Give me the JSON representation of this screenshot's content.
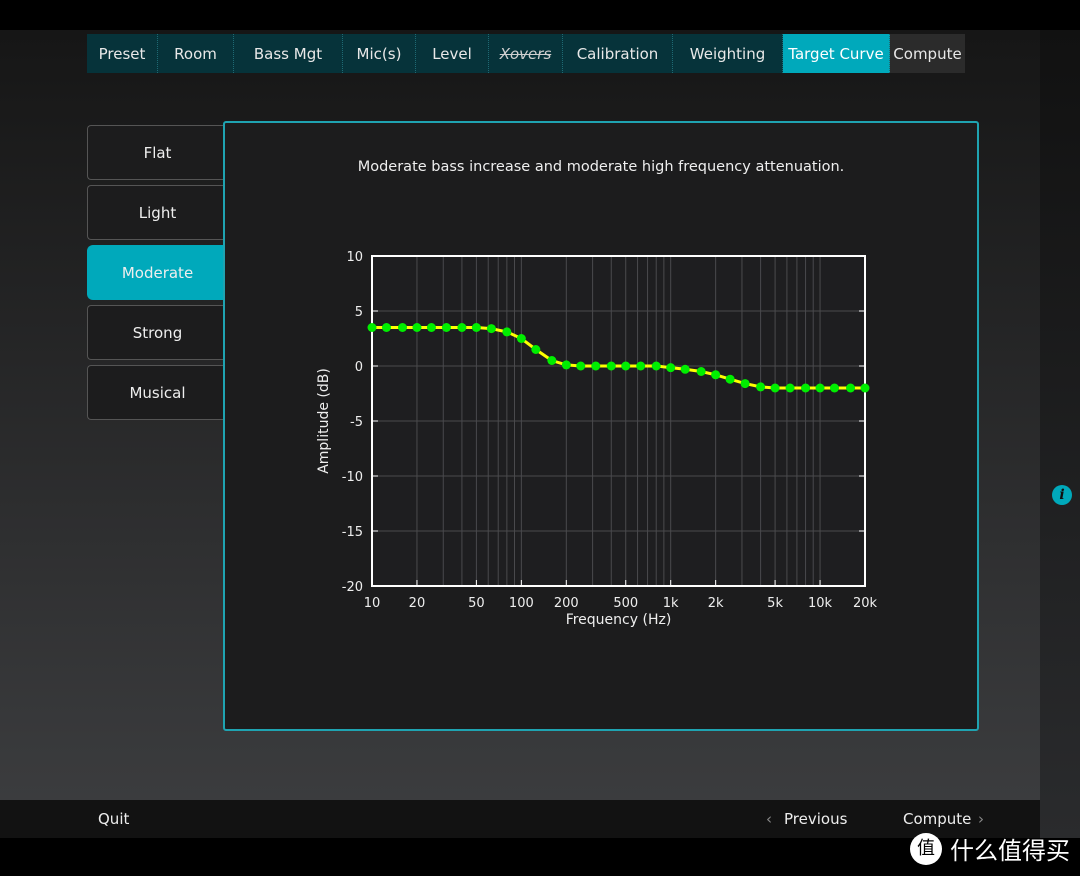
{
  "tabs": [
    {
      "label": "Preset"
    },
    {
      "label": "Room"
    },
    {
      "label": "Bass Mgt"
    },
    {
      "label": "Mic(s)"
    },
    {
      "label": "Level"
    },
    {
      "label": "Xovers"
    },
    {
      "label": "Calibration"
    },
    {
      "label": "Weighting"
    },
    {
      "label": "Target Curve"
    },
    {
      "label": "Compute"
    }
  ],
  "active_tab": "Target Curve",
  "presets": [
    {
      "label": "Flat"
    },
    {
      "label": "Light"
    },
    {
      "label": "Moderate"
    },
    {
      "label": "Strong"
    },
    {
      "label": "Musical"
    }
  ],
  "selected_preset": "Moderate",
  "description": "Moderate bass increase and moderate high frequency attenuation.",
  "footer": {
    "quit": "Quit",
    "previous": "Previous",
    "next": "Compute",
    "prev_icon": "‹",
    "next_icon": "›"
  },
  "info_icon": "i",
  "watermark": {
    "badge": "值",
    "text": "什么值得买"
  },
  "colors": {
    "accent": "#00a9bb",
    "line": "#ffff00",
    "points": "#00ee00"
  },
  "chart_data": {
    "type": "line",
    "xlabel": "Frequency (Hz)",
    "ylabel": "Amplitude (dB)",
    "xscale": "log",
    "xlim": [
      10,
      20000
    ],
    "ylim": [
      -20,
      10
    ],
    "grid": true,
    "xticks": [
      10,
      20,
      50,
      100,
      200,
      500,
      1000,
      2000,
      5000,
      10000,
      20000
    ],
    "xticklabels": [
      "10",
      "20",
      "50",
      "100",
      "200",
      "500",
      "1k",
      "2k",
      "5k",
      "10k",
      "20k"
    ],
    "yticks": [
      10,
      5,
      0,
      -5,
      -10,
      -15,
      -20
    ],
    "yticklabels": [
      "10",
      "5",
      "0",
      "-5",
      "-10",
      "-15",
      "-20"
    ],
    "x": [
      10,
      12.5,
      16,
      20,
      25,
      31.5,
      40,
      50,
      63,
      80,
      100,
      125,
      160,
      200,
      250,
      315,
      400,
      500,
      630,
      800,
      1000,
      1250,
      1600,
      2000,
      2500,
      3150,
      4000,
      5000,
      6300,
      8000,
      10000,
      12500,
      16000,
      20000
    ],
    "y": [
      3.5,
      3.5,
      3.5,
      3.5,
      3.5,
      3.5,
      3.5,
      3.5,
      3.4,
      3.1,
      2.5,
      1.5,
      0.5,
      0.1,
      0,
      0,
      0,
      0,
      0,
      0,
      -0.15,
      -0.3,
      -0.5,
      -0.8,
      -1.2,
      -1.6,
      -1.9,
      -2,
      -2,
      -2,
      -2,
      -2,
      -2,
      -2
    ]
  }
}
